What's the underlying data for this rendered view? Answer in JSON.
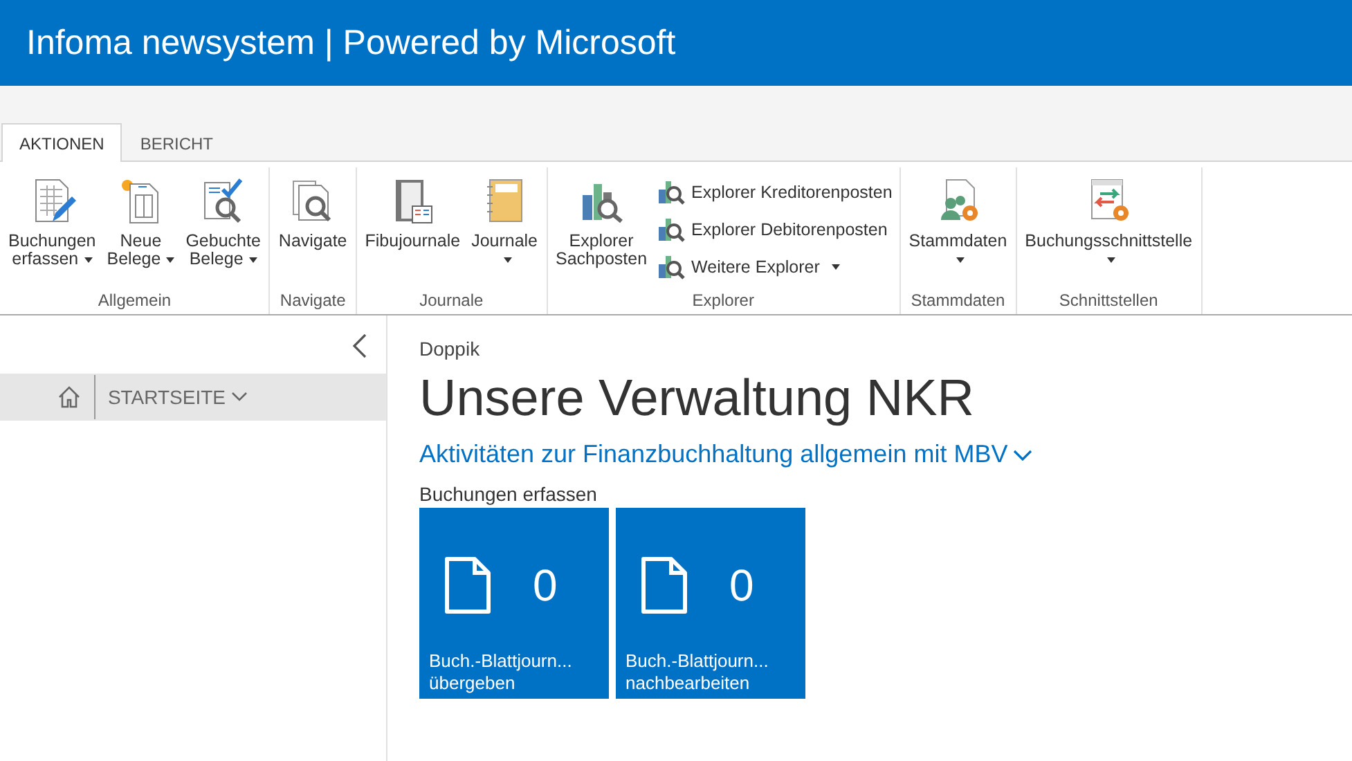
{
  "header": {
    "title": "Infoma newsystem | Powered by Microsoft"
  },
  "tabs": [
    {
      "label": "AKTIONEN",
      "selected": true
    },
    {
      "label": "BERICHT",
      "selected": false
    }
  ],
  "ribbon_groups": [
    {
      "label": "Allgemein",
      "items": [
        {
          "kind": "large",
          "lines": [
            "Buchungen",
            "erfassen"
          ],
          "dropdown": true
        },
        {
          "kind": "large",
          "lines": [
            "Neue",
            "Belege"
          ],
          "dropdown": true
        },
        {
          "kind": "large",
          "lines": [
            "Gebuchte",
            "Belege"
          ],
          "dropdown": true
        }
      ]
    },
    {
      "label": "Navigate",
      "items": [
        {
          "kind": "large",
          "lines": [
            "Navigate"
          ],
          "dropdown": false
        }
      ]
    },
    {
      "label": "Journale",
      "items": [
        {
          "kind": "large",
          "lines": [
            "Fibujournale"
          ],
          "dropdown": false
        },
        {
          "kind": "large",
          "lines": [
            "Journale"
          ],
          "dropdown": true
        }
      ]
    },
    {
      "label": "Explorer",
      "items": [
        {
          "kind": "large",
          "lines": [
            "Explorer",
            "Sachposten"
          ],
          "dropdown": false
        },
        {
          "kind": "small",
          "lines": [
            "Explorer Kreditorenposten"
          ],
          "dropdown": false
        },
        {
          "kind": "small",
          "lines": [
            "Explorer Debitorenposten"
          ],
          "dropdown": false
        },
        {
          "kind": "small",
          "lines": [
            "Weitere Explorer"
          ],
          "dropdown": true
        }
      ]
    },
    {
      "label": "Stammdaten",
      "items": [
        {
          "kind": "large",
          "lines": [
            "Stammdaten"
          ],
          "dropdown": true
        }
      ]
    },
    {
      "label": "Schnittstellen",
      "items": [
        {
          "kind": "large",
          "lines": [
            "Buchungsschnittstelle"
          ],
          "dropdown": true
        }
      ]
    }
  ],
  "nav": {
    "home_label": "STARTSEITE"
  },
  "content": {
    "breadcrumb": "Doppik",
    "title": "Unsere Verwaltung NKR",
    "section_link": "Aktivitäten zur Finanzbuchhaltung allgemein mit MBV",
    "subheading": "Buchungen erfassen",
    "tiles": [
      {
        "count": "0",
        "label": "Buch.-Blattjourn...",
        "sublabel": "übergeben"
      },
      {
        "count": "0",
        "label": "Buch.-Blattjourn...",
        "sublabel": "nachbearbeiten"
      }
    ]
  }
}
